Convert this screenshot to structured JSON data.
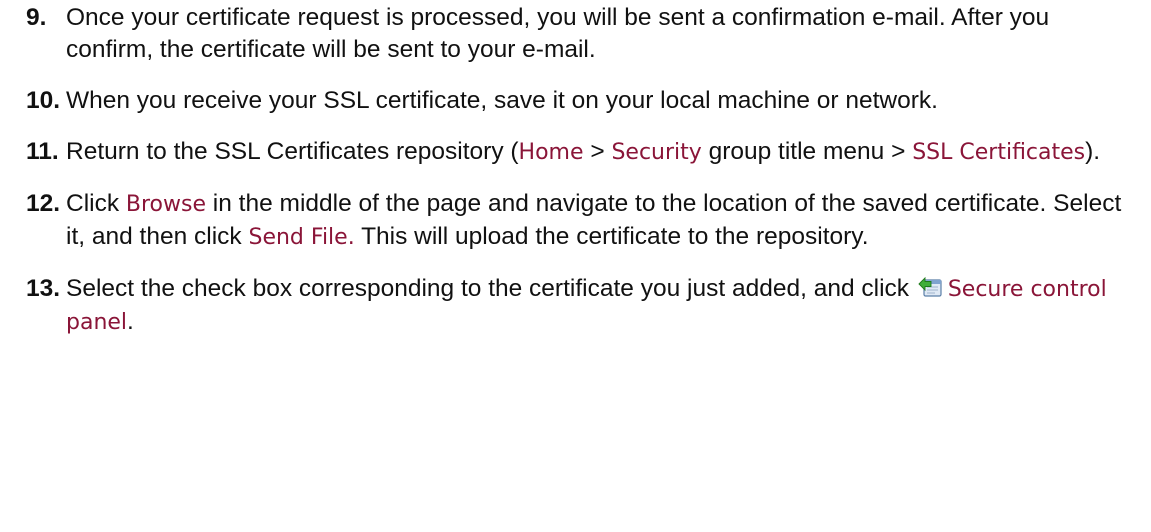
{
  "steps": [
    {
      "number": "9.",
      "parts": [
        {
          "type": "text",
          "value": "Once your certificate request is processed, you will be sent a confirmation e-mail. After you confirm, the certificate will be sent to your e-mail."
        }
      ]
    },
    {
      "number": "10.",
      "parts": [
        {
          "type": "text",
          "value": "When you receive your SSL certificate, save it on your local machine or network."
        }
      ]
    },
    {
      "number": "11.",
      "parts": [
        {
          "type": "text",
          "value": "Return to the SSL Certificates repository ("
        },
        {
          "type": "ui",
          "value": "Home"
        },
        {
          "type": "text",
          "value": " > "
        },
        {
          "type": "ui",
          "value": "Security"
        },
        {
          "type": "text",
          "value": " group title menu > "
        },
        {
          "type": "ui",
          "value": "SSL Certificates"
        },
        {
          "type": "text",
          "value": ")."
        }
      ]
    },
    {
      "number": "12.",
      "parts": [
        {
          "type": "text",
          "value": "Click "
        },
        {
          "type": "ui",
          "value": "Browse"
        },
        {
          "type": "text",
          "value": " in the middle of the page and navigate to the location of the saved certificate. Select it, and then click "
        },
        {
          "type": "ui",
          "value": "Send File."
        },
        {
          "type": "text",
          "value": " This will upload the certificate to the repository."
        }
      ]
    },
    {
      "number": "13.",
      "parts": [
        {
          "type": "text",
          "value": "Select the check box corresponding to the certificate you just added, and click "
        },
        {
          "type": "icon",
          "value": "secure-panel-icon"
        },
        {
          "type": "ui",
          "value": "Secure control panel"
        },
        {
          "type": "text",
          "value": "."
        }
      ]
    }
  ],
  "colors": {
    "ui_term": "#8a1538",
    "body_text": "#111111"
  }
}
